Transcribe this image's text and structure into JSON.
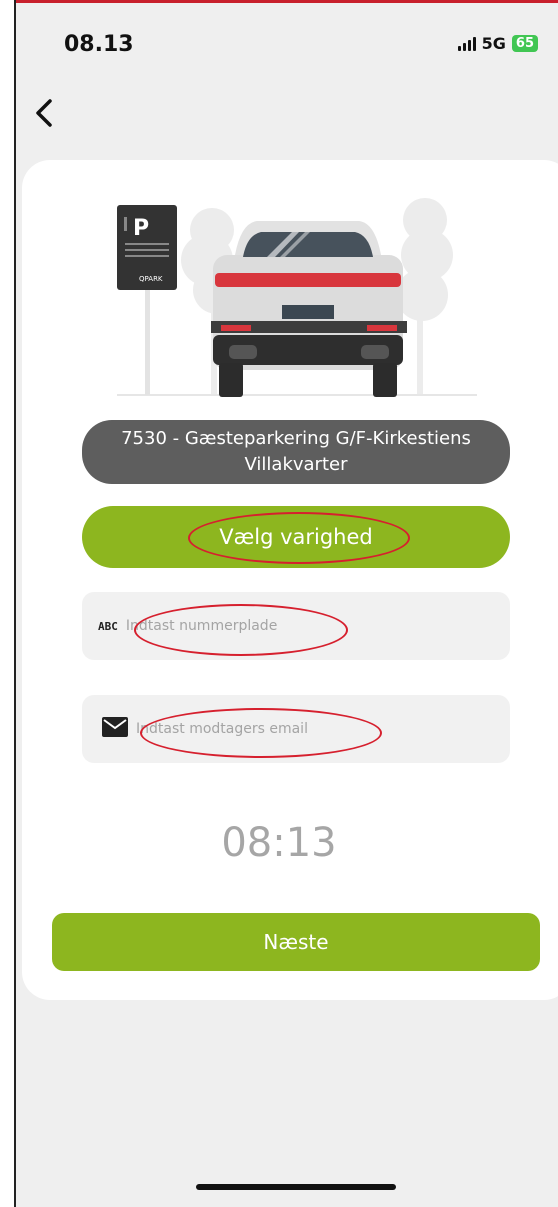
{
  "status_bar": {
    "time": "08.13",
    "network": "5G",
    "battery": "65",
    "battery_color": "#41c653"
  },
  "nav": {
    "back_icon": "chevron-left-icon"
  },
  "illustration": {
    "sign_letter": "P",
    "sign_brand": "QPARK"
  },
  "parking": {
    "location": "7530 - Gæsteparkering G/F-Kirkestiens Villakvarter"
  },
  "duration": {
    "label": "Vælg varighed"
  },
  "plate_field": {
    "icon_label": "ABC",
    "placeholder": "Indtast nummerplade"
  },
  "email_field": {
    "icon": "envelope-icon",
    "placeholder": "Indtast modtagers email"
  },
  "clock": {
    "time": "08:13"
  },
  "next_button": {
    "label": "Næste"
  },
  "colors": {
    "accent_green": "#8db61f",
    "location_bg": "#5e5e5e",
    "highlight_red": "#d6202e"
  }
}
